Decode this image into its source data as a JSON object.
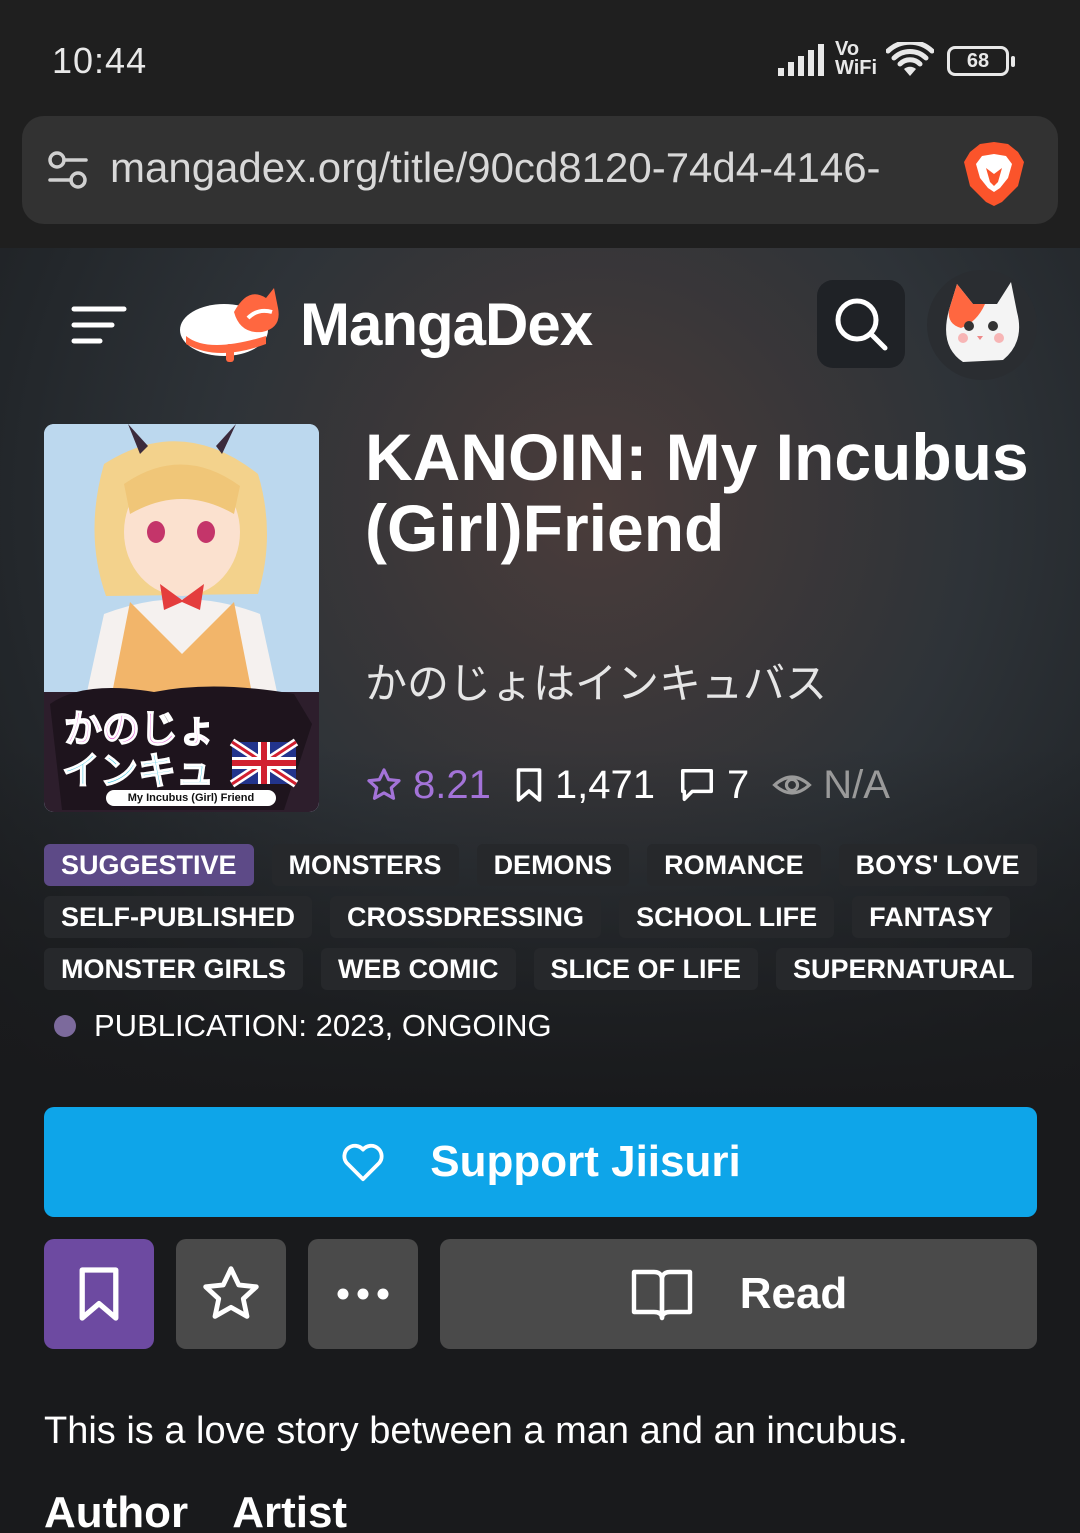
{
  "status_bar": {
    "time": "10:44",
    "network_label": "Vo WiFi",
    "battery": "68"
  },
  "browser": {
    "url": "mangadex.org/title/90cd8120-74d4-4146-",
    "site_settings_icon": "tune-icon",
    "shield_icon": "brave-lion-icon"
  },
  "header": {
    "brand": "MangaDex",
    "menu_icon": "hamburger-icon",
    "search_icon": "search-icon"
  },
  "manga": {
    "title": "KANOIN: My Incubus (Girl)Friend",
    "alt_title": "かのじょはインキュバス",
    "cover_text": "My Incubus (Girl) Friend",
    "stats": {
      "rating": "8.21",
      "follows": "1,471",
      "comments": "7",
      "views": "N/A"
    },
    "tags": [
      [
        "SUGGESTIVE",
        "MONSTERS",
        "DEMONS",
        "ROMANCE",
        "BOYS' LOVE"
      ],
      [
        "SELF-PUBLISHED",
        "CROSSDRESSING",
        "SCHOOL LIFE",
        "FANTASY"
      ],
      [
        "MONSTER GIRLS",
        "WEB COMIC",
        "SLICE OF LIFE",
        "SUPERNATURAL"
      ]
    ],
    "publication": "PUBLICATION: 2023, ONGOING",
    "description": "This is a love story between a man and an incubus."
  },
  "actions": {
    "support_label": "Support Jiisuri",
    "read_label": "Read"
  },
  "credits": {
    "author_label": "Author",
    "artist_label": "Artist"
  },
  "colors": {
    "accent_purple": "#6d4aa1",
    "support_blue": "#0ea5e9",
    "rating_purple": "#a373d8",
    "brand_orange": "#ff6740"
  }
}
